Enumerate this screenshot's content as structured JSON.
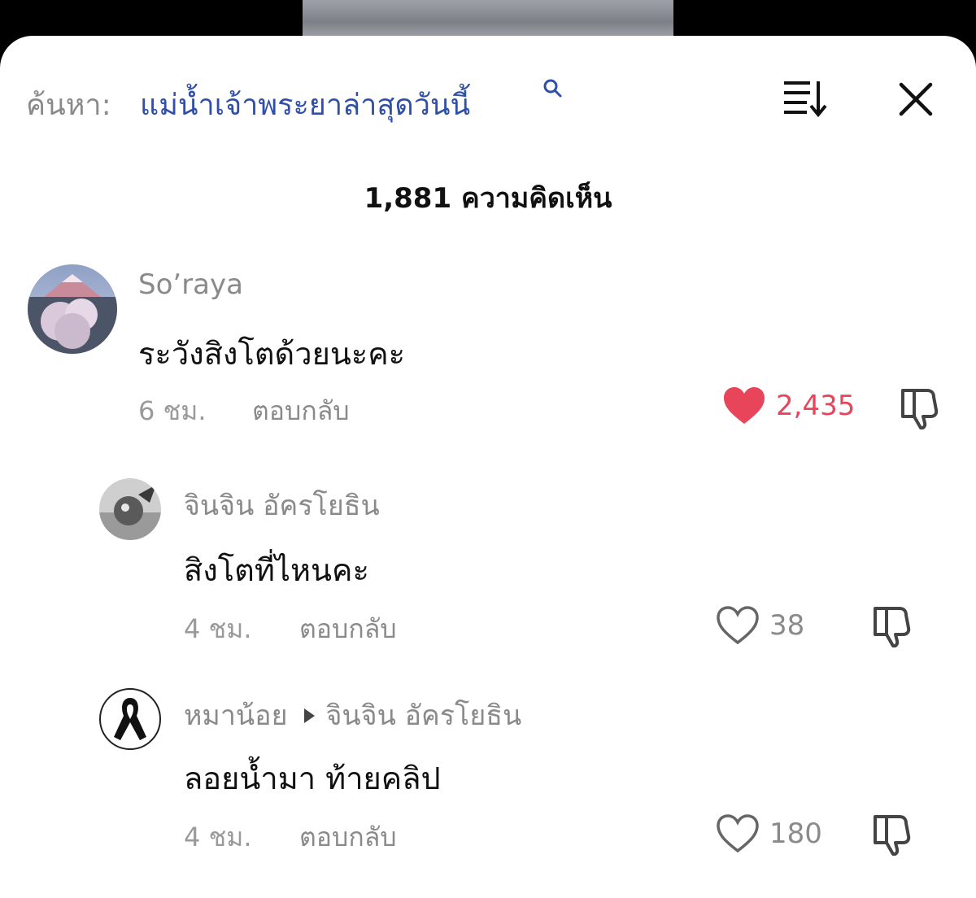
{
  "header": {
    "search_prefix": "ค้นหา:",
    "search_term": "แม่น้ำเจ้าพระยาล่าสุดวันนี้",
    "icons": [
      "search-icon",
      "sort-icon",
      "close-icon"
    ]
  },
  "comment_count": "1,881 ความคิดเห็น",
  "comments": [
    {
      "username": "So’raya",
      "text": "ระวังสิงโตด้วยนะคะ",
      "time": "6 ชม.",
      "reply_label": "ตอบกลับ",
      "likes": "2,435",
      "liked": true
    }
  ],
  "replies": [
    {
      "username": "จินจิน อัครโยธิน",
      "text": "สิงโตที่ไหนคะ",
      "time": "4 ชม.",
      "reply_label": "ตอบกลับ",
      "likes": "38",
      "liked": false
    },
    {
      "username": "หมาน้อย",
      "reply_to": "จินจิน อัครโยธิน",
      "text": "ลอยน้ำมา ท้ายคลิป",
      "time": "4 ชม.",
      "reply_label": "ตอบกลับ",
      "likes": "180",
      "liked": false
    }
  ],
  "colors": {
    "link_blue": "#2f4fa8",
    "like_red": "#e8445a",
    "muted_gray": "#8a8a8a"
  }
}
